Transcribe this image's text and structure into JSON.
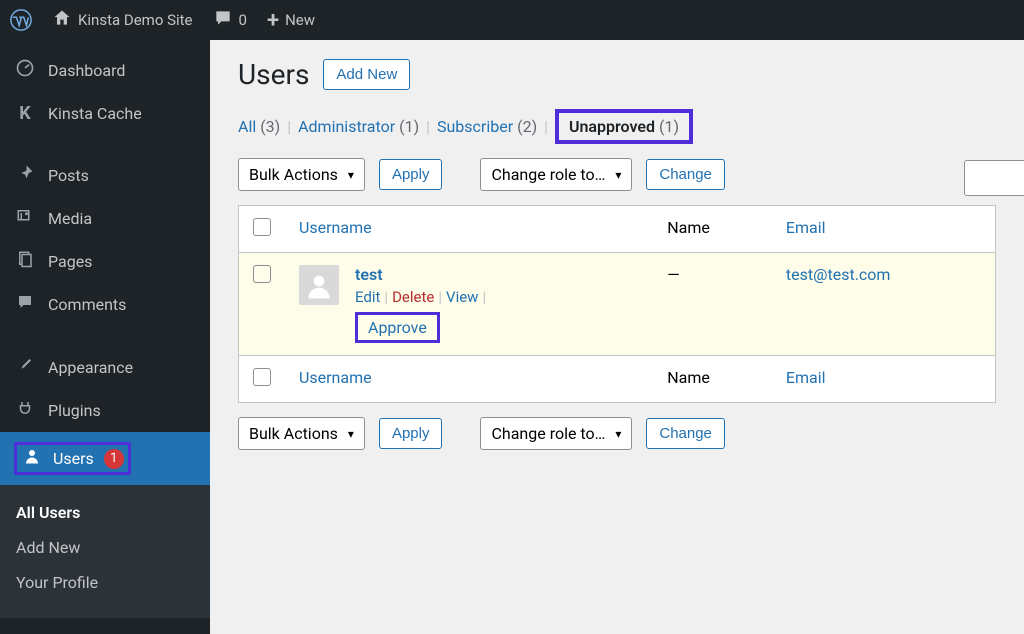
{
  "topbar": {
    "site_name": "Kinsta Demo Site",
    "comments_count": "0",
    "new_label": "New"
  },
  "sidebar": {
    "dashboard": "Dashboard",
    "kinsta_cache": "Kinsta Cache",
    "posts": "Posts",
    "media": "Media",
    "pages": "Pages",
    "comments": "Comments",
    "appearance": "Appearance",
    "plugins": "Plugins",
    "users": "Users",
    "users_badge": "1",
    "submenu": {
      "all_users": "All Users",
      "add_new": "Add New",
      "your_profile": "Your Profile"
    }
  },
  "page": {
    "title": "Users",
    "add_new": "Add New"
  },
  "filters": {
    "all_label": "All",
    "all_count": "(3)",
    "admin_label": "Administrator",
    "admin_count": "(1)",
    "subscriber_label": "Subscriber",
    "subscriber_count": "(2)",
    "unapproved_label": "Unapproved",
    "unapproved_count": "(1)"
  },
  "actions": {
    "bulk_label": "Bulk Actions",
    "apply_label": "Apply",
    "role_label": "Change role to…",
    "change_label": "Change"
  },
  "table": {
    "username_header": "Username",
    "name_header": "Name",
    "email_header": "Email",
    "row": {
      "username": "test",
      "name": "—",
      "email": "test@test.com",
      "edit": "Edit",
      "delete": "Delete",
      "view": "View",
      "approve": "Approve"
    }
  }
}
